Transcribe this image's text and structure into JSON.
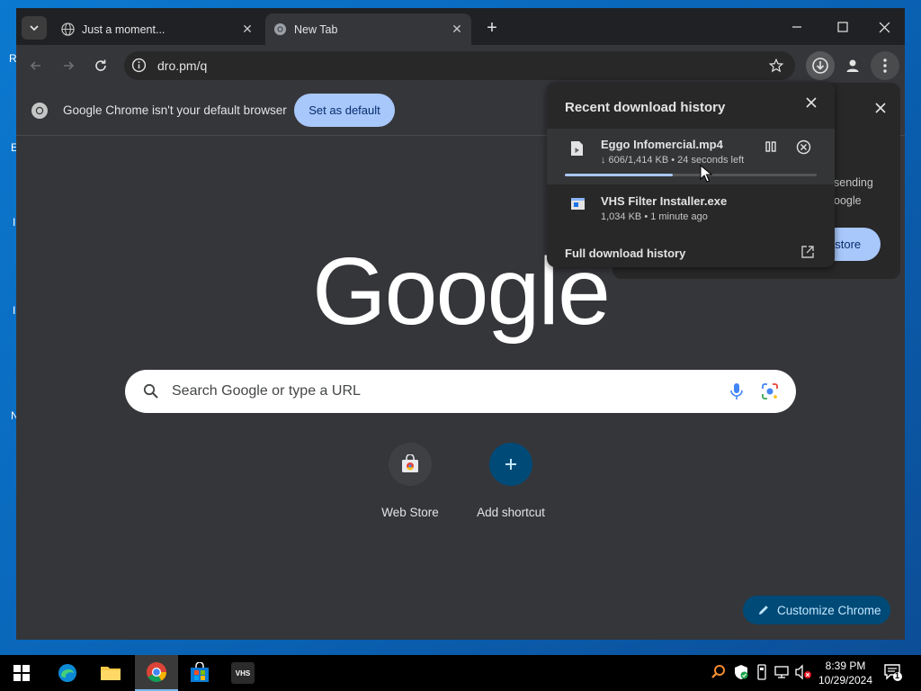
{
  "desktop": {
    "edge_letters": [
      "R",
      "E",
      "I",
      "I",
      "N"
    ]
  },
  "tabs": [
    {
      "title": "Just a moment...",
      "icon": "globe-icon"
    },
    {
      "title": "New Tab",
      "icon": "chrome-icon"
    }
  ],
  "toolbar": {
    "url": "dro.pm/q"
  },
  "infobar": {
    "message": "Google Chrome isn't your default browser",
    "button": "Set as default"
  },
  "promo": {
    "line1": "sending",
    "line2": "oogle",
    "button": "estore"
  },
  "downloads": {
    "title": "Recent download history",
    "items": [
      {
        "name": "Eggo Infomercial.mp4",
        "status": "↓ 606/1,414 KB • 24 seconds left",
        "progress": 0.43,
        "active": true
      },
      {
        "name": "VHS Filter Installer.exe",
        "status": "1,034 KB • 1 minute ago"
      }
    ],
    "full_history": "Full download history"
  },
  "newtab": {
    "logo": "Google",
    "search_placeholder": "Search Google or type a URL",
    "shortcuts": [
      {
        "label": "Web Store",
        "icon": "webstore-icon"
      },
      {
        "label": "Add shortcut",
        "icon": "plus-icon"
      }
    ],
    "customize": "Customize Chrome"
  },
  "taskbar": {
    "apps": [
      "start",
      "edge",
      "file-explorer",
      "chrome",
      "store",
      "vhs"
    ],
    "vhs_label": "VHS",
    "time": "8:39 PM",
    "date": "10/29/2024",
    "notification_count": "1"
  },
  "colors": {
    "accent": "#a8c7fa",
    "chrome_dark": "#202124",
    "surface": "#35363a",
    "customize_bg": "#004a77"
  }
}
